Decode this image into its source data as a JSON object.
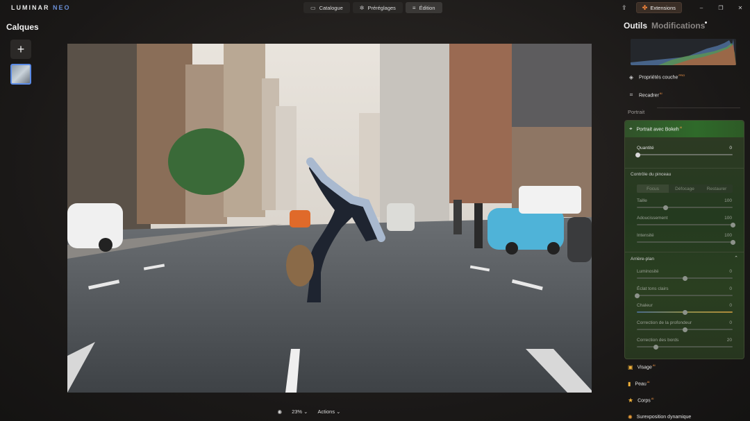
{
  "app": {
    "logo_main": "LUMINAR",
    "logo_sub": "NEO"
  },
  "modes": [
    {
      "label": "Catalogue",
      "icon": "folder-icon"
    },
    {
      "label": "Préréglages",
      "icon": "presets-icon"
    },
    {
      "label": "Édition",
      "icon": "sliders-icon",
      "active": true
    }
  ],
  "topright": {
    "extensions_label": "Extensions"
  },
  "layers": {
    "title": "Calques",
    "add_symbol": "+"
  },
  "bottom": {
    "zoom": "23%",
    "actions": "Actions"
  },
  "panel": {
    "tab_tools": "Outils",
    "tab_edits": "Modifications",
    "layer_props": "Propriétés couche",
    "layer_props_badge": "PRO",
    "crop": "Recadrer",
    "crop_badge": "AI",
    "section_portrait": "Portrait",
    "bokeh": {
      "title": "Portrait avec Bokeh",
      "badge": "AI",
      "amount_label": "Quantité",
      "amount_value": "0",
      "brush_title": "Contrôle du pinceau",
      "segments": [
        "Focus",
        "Défocage",
        "Restaurer"
      ],
      "brush_sliders": [
        {
          "label": "Taille",
          "value": "100",
          "pos": 0.3
        },
        {
          "label": "Adoucissement",
          "value": "100",
          "pos": 1.0
        },
        {
          "label": "Intensité",
          "value": "100",
          "pos": 1.0
        }
      ],
      "bg_title": "Arrière-plan",
      "bg_sliders": [
        {
          "label": "Luminosité",
          "value": "0",
          "pos": 0.5
        },
        {
          "label": "Éclat tons clairs",
          "value": "0",
          "pos": 0.0
        },
        {
          "label": "Chaleur",
          "value": "0",
          "pos": 0.5
        },
        {
          "label": "Correction de la profondeur",
          "value": "0",
          "pos": 0.5
        },
        {
          "label": "Correction des bords",
          "value": "20",
          "pos": 0.2
        }
      ]
    },
    "tools_below": [
      {
        "label": "Visage",
        "badge": "AI",
        "icon": "face-icon"
      },
      {
        "label": "Peau",
        "badge": "AI",
        "icon": "skin-icon"
      },
      {
        "label": "Corps",
        "badge": "AI",
        "icon": "body-icon"
      },
      {
        "label": "Surexposition dynamique",
        "badge": "",
        "icon": "sun-icon"
      }
    ]
  }
}
